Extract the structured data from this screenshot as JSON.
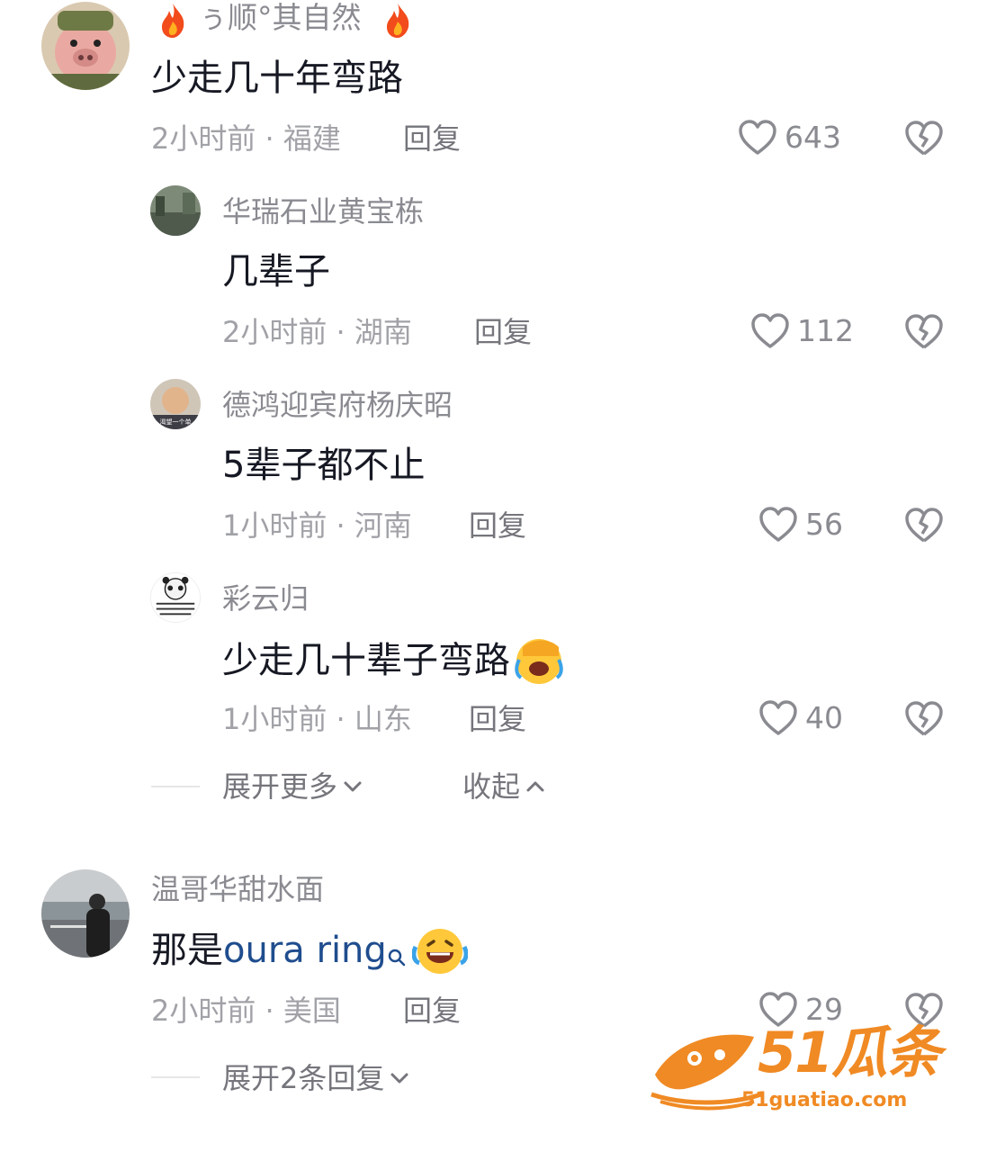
{
  "comments": [
    {
      "name": "ぅ顺°其自然",
      "text": "少走几十年弯路",
      "time_location": "2小时前 · 福建",
      "reply_label": "回复",
      "likes": "643",
      "name_icons": [
        "fire-icon",
        "fire-icon"
      ]
    },
    {
      "name": "华瑞石业黄宝栋",
      "text": "几辈子",
      "time_location": "2小时前 · 湖南",
      "reply_label": "回复",
      "likes": "112"
    },
    {
      "name": "德鸿迎宾府杨庆昭",
      "text": "5辈子都不止",
      "time_location": "1小时前 · 河南",
      "reply_label": "回复",
      "likes": "56",
      "avatar_text": "渴望一个单"
    },
    {
      "name": "彩云归",
      "text": "少走几十辈子弯路",
      "time_location": "1小时前 · 山东",
      "reply_label": "回复",
      "likes": "40",
      "text_emoji": "facepalm-laugh-emoji"
    },
    {
      "name": "温哥华甜水面",
      "text_prefix": "那是",
      "link_text": "oura ring",
      "time_location": "2小时前 · 美国",
      "reply_label": "回复",
      "likes": "29",
      "text_emoji": "laughing-tears-emoji"
    }
  ],
  "thread_controls": {
    "expand_more": "展开更多",
    "collapse": "收起",
    "expand_replies": "展开2条回复"
  },
  "watermark": {
    "brand": "51瓜条",
    "domain": "51guatiao.com",
    "color": "#f08a24"
  },
  "colors": {
    "name": "#8a8b91",
    "text": "#161823",
    "meta": "#a1a2a7",
    "link": "#1f4d8e"
  }
}
